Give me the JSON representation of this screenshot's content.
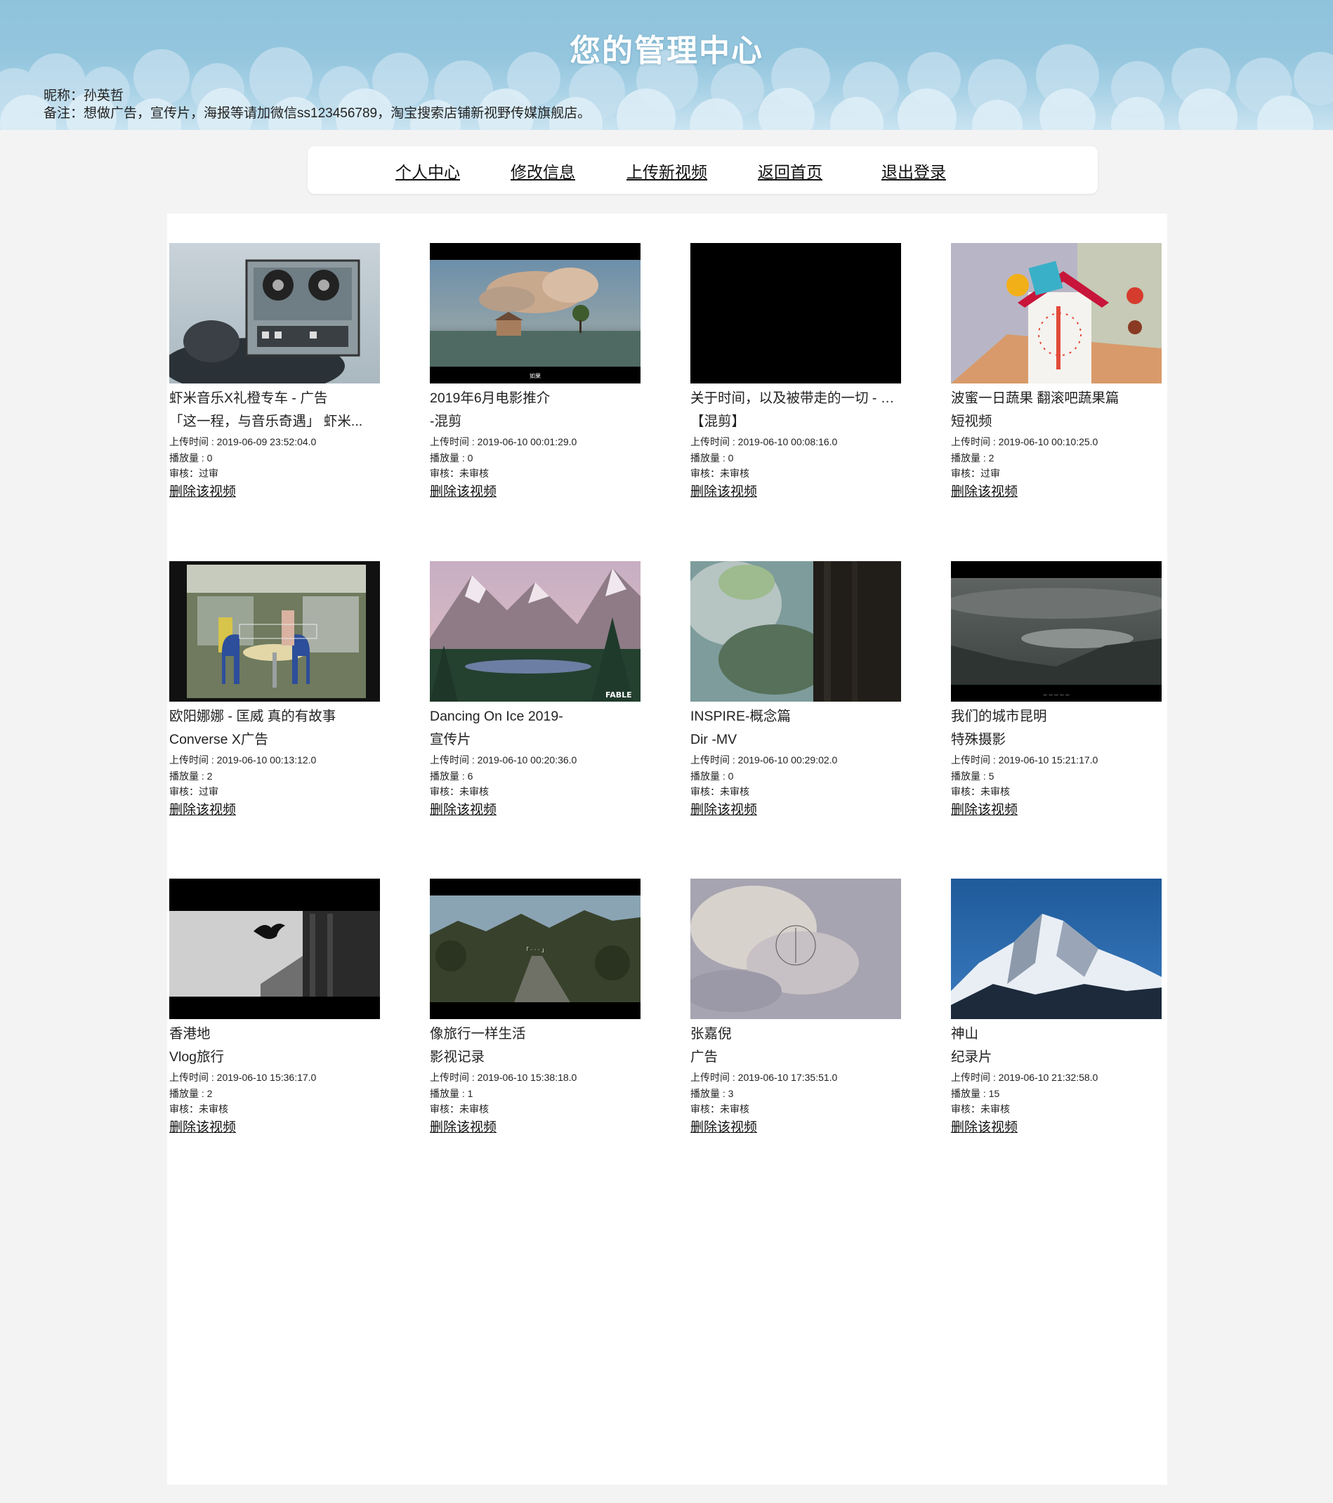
{
  "header": {
    "title": "您的管理中心",
    "nickname": "昵称：孙英哲",
    "remark": "备注：想做广告，宣传片，海报等请加微信ss123456789，淘宝搜索店铺新视野传媒旗舰店。"
  },
  "nav": {
    "items": [
      {
        "label": "个人中心"
      },
      {
        "label": "修改信息"
      },
      {
        "label": "上传新视频"
      },
      {
        "label": "返回首页"
      },
      {
        "label": "退出登录"
      }
    ]
  },
  "videos": [
    {
      "title_line1": "虾米音乐X礼橙专车 - 广告",
      "title_line2": "「这一程，与音乐奇遇」 虾米...",
      "upload_time": "上传时间 : 2019-06-09 23:52:04.0",
      "plays": "播放量 : 0",
      "review": "审核：过审",
      "delete_label": "删除该视频",
      "thumb": "tape-recorder"
    },
    {
      "title_line1": "2019年6月电影推介",
      "title_line2": "-混剪",
      "upload_time": "上传时间 : 2019-06-10 00:01:29.0",
      "plays": "播放量 : 0",
      "review": "审核：未审核",
      "delete_label": "删除该视频",
      "thumb": "cloud-landscape"
    },
    {
      "title_line1": "关于时间，以及被带走的一切 - 混剪",
      "title_line2": "【混剪】",
      "upload_time": "上传时间 : 2019-06-10 00:08:16.0",
      "plays": "播放量 : 0",
      "review": "审核：未审核",
      "delete_label": "删除该视频",
      "thumb": "black"
    },
    {
      "title_line1": "波蜜一日蔬果 翻滚吧蔬果篇",
      "title_line2": "短视频",
      "upload_time": "上传时间 : 2019-06-10 00:10:25.0",
      "plays": "播放量 : 2",
      "review": "审核：过审",
      "delete_label": "删除该视频",
      "thumb": "toy-house"
    },
    {
      "title_line1": "欧阳娜娜 - 匡威 真的有故事",
      "title_line2": "Converse X广告",
      "upload_time": "上传时间 : 2019-06-10 00:13:12.0",
      "plays": "播放量 : 2",
      "review": "审核：过审",
      "delete_label": "删除该视频",
      "thumb": "diner"
    },
    {
      "title_line1": "Dancing On Ice 2019-",
      "title_line2": "宣传片",
      "upload_time": "上传时间 : 2019-06-10 00:20:36.0",
      "plays": "播放量 : 6",
      "review": "审核：未审核",
      "delete_label": "删除该视频",
      "thumb": "mountains"
    },
    {
      "title_line1": "INSPIRE-概念篇",
      "title_line2": "Dir -MV",
      "upload_time": "上传时间 : 2019-06-10 00:29:02.0",
      "plays": "播放量 : 0",
      "review": "审核：未审核",
      "delete_label": "删除该视频",
      "thumb": "tree-trunk"
    },
    {
      "title_line1": "我们的城市昆明",
      "title_line2": "特殊摄影",
      "upload_time": "上传时间 : 2019-06-10 15:21:17.0",
      "plays": "播放量 : 5",
      "review": "审核：未审核",
      "delete_label": "删除该视频",
      "thumb": "misty-lake"
    },
    {
      "title_line1": "香港地",
      "title_line2": "Vlog旅行",
      "upload_time": "上传时间 : 2019-06-10 15:36:17.0",
      "plays": "播放量 : 2",
      "review": "审核：未审核",
      "delete_label": "删除该视频",
      "thumb": "bird-bw"
    },
    {
      "title_line1": "像旅行一样生活",
      "title_line2": "影视记录",
      "upload_time": "上传时间 : 2019-06-10 15:38:18.0",
      "plays": "播放量 : 1",
      "review": "审核：未审核",
      "delete_label": "删除该视频",
      "thumb": "forest-road"
    },
    {
      "title_line1": "张嘉倪",
      "title_line2": "广告",
      "upload_time": "上传时间 : 2019-06-10 17:35:51.0",
      "plays": "播放量 : 3",
      "review": "审核：未审核",
      "delete_label": "删除该视频",
      "thumb": "smoke-logo"
    },
    {
      "title_line1": "神山",
      "title_line2": "纪录片",
      "upload_time": "上传时间 : 2019-06-10 21:32:58.0",
      "plays": "播放量 : 15",
      "review": "审核：未审核",
      "delete_label": "删除该视频",
      "thumb": "snow-peak"
    }
  ]
}
